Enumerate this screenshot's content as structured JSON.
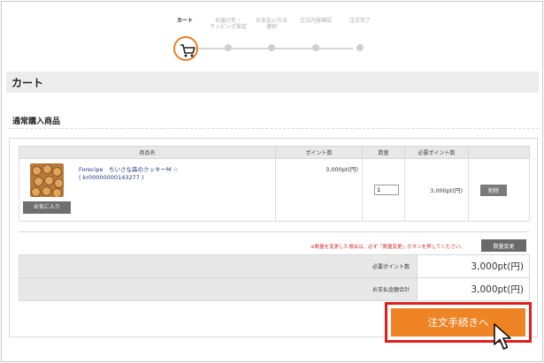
{
  "steps": [
    {
      "label": "カート",
      "active": true
    },
    {
      "label": "お届け先・\nラッピング設定",
      "active": false
    },
    {
      "label": "お支払い方法\n選択",
      "active": false
    },
    {
      "label": "注文内容確認",
      "active": false
    },
    {
      "label": "注文完了",
      "active": false
    }
  ],
  "page_title": "カート",
  "section_title": "通常購入商品",
  "table": {
    "headers": [
      "商品名",
      "ポイント数",
      "数量",
      "必要ポイント数",
      ""
    ],
    "rows": [
      {
        "product_name": "Forecipe　ちいさな森のクッキーM ☆",
        "product_code": "( kr00000000143277 )",
        "favorite_label": "お気に入り",
        "points": "3,000pt(円)",
        "quantity": "1",
        "required_points": "3,000pt(円)",
        "delete_label": "削除"
      }
    ]
  },
  "qty_note": "※数量を変更した場合は、必ず「数量変更」ボタンを押してください。",
  "qty_change_label": "数量変更",
  "summary": [
    {
      "label": "必要ポイント数",
      "value": "3,000pt(円)"
    },
    {
      "label": "お支払金額合計",
      "value": "3,000pt(円)"
    }
  ],
  "proceed_label": "注文手続きへ",
  "colors": {
    "accent": "#ee8424",
    "highlight": "#e01e1e",
    "link": "#1f3a80",
    "note": "#d23030"
  },
  "icons": {
    "cart": "cart-icon",
    "cursor": "mouse-pointer-icon"
  }
}
